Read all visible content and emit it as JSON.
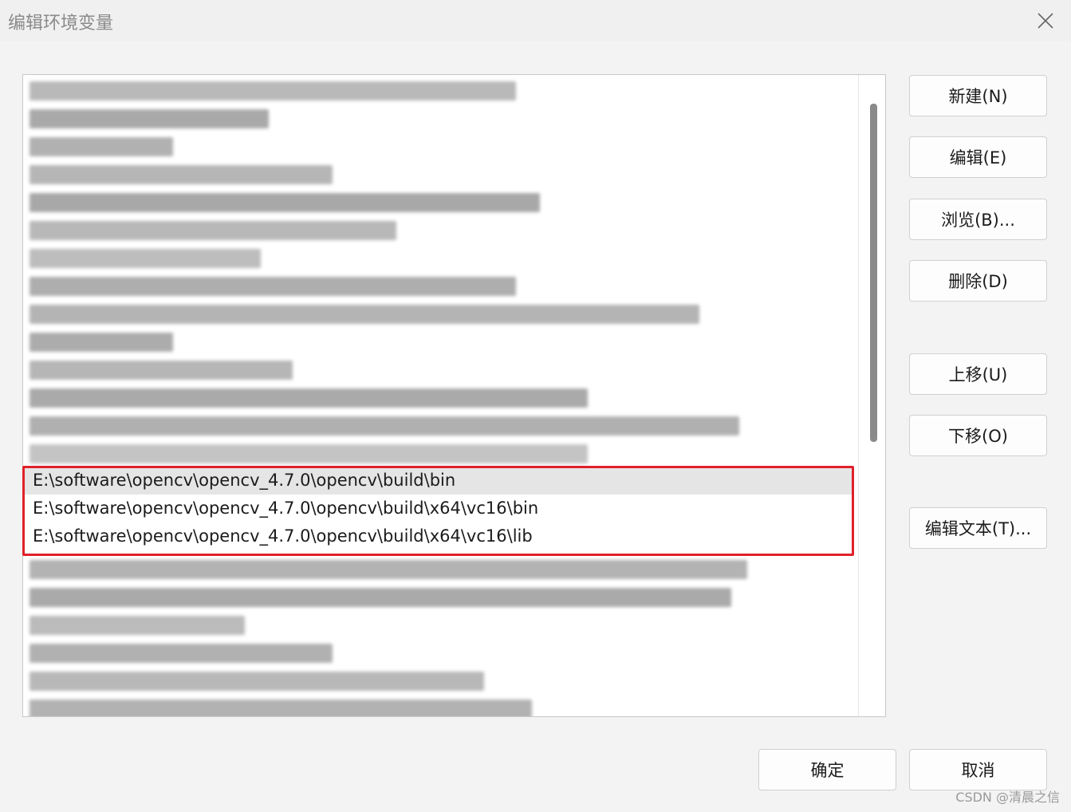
{
  "window": {
    "title": "编辑环境变量"
  },
  "list": {
    "visible_rows": [
      "E:\\software\\opencv\\opencv_4.7.0\\opencv\\build\\bin",
      "E:\\software\\opencv\\opencv_4.7.0\\opencv\\build\\x64\\vc16\\bin",
      "E:\\software\\opencv\\opencv_4.7.0\\opencv\\build\\x64\\vc16\\lib"
    ]
  },
  "buttons": {
    "new": "新建(N)",
    "edit": "编辑(E)",
    "browse": "浏览(B)...",
    "delete": "删除(D)",
    "move_up": "上移(U)",
    "move_down": "下移(O)",
    "edit_text": "编辑文本(T)...",
    "ok": "确定",
    "cancel": "取消"
  },
  "watermark": "CSDN @清晨之信",
  "colors": {
    "highlight_border": "#e0212a",
    "selected_row": "#e5e5e5"
  }
}
